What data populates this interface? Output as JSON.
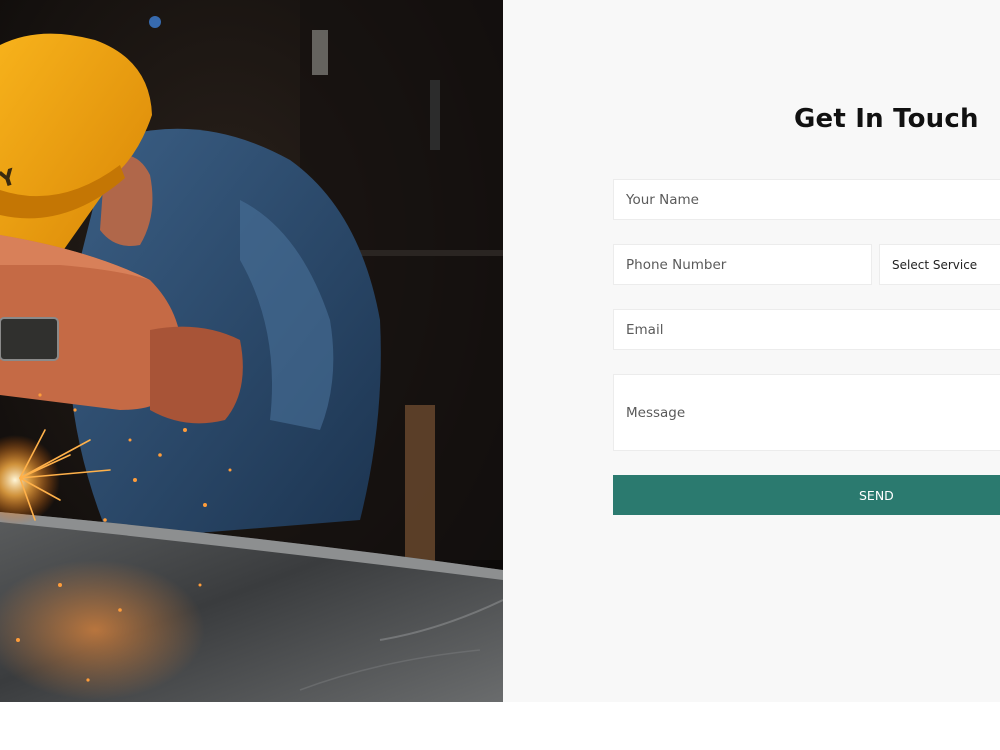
{
  "photo": {
    "alt": "Welder wearing a yellow hard hat working on a metal sheet with sparks"
  },
  "contact_form": {
    "title": "Get In Touch",
    "name_placeholder": "Your Name",
    "phone_placeholder": "Phone Number",
    "service_selected": "Select Service",
    "email_placeholder": "Email",
    "message_placeholder": "Message",
    "send_label": "SEND"
  },
  "colors": {
    "accent": "#2b7a6f",
    "panel_background": "#f8f8f8",
    "helmet": "#f0a30a"
  }
}
